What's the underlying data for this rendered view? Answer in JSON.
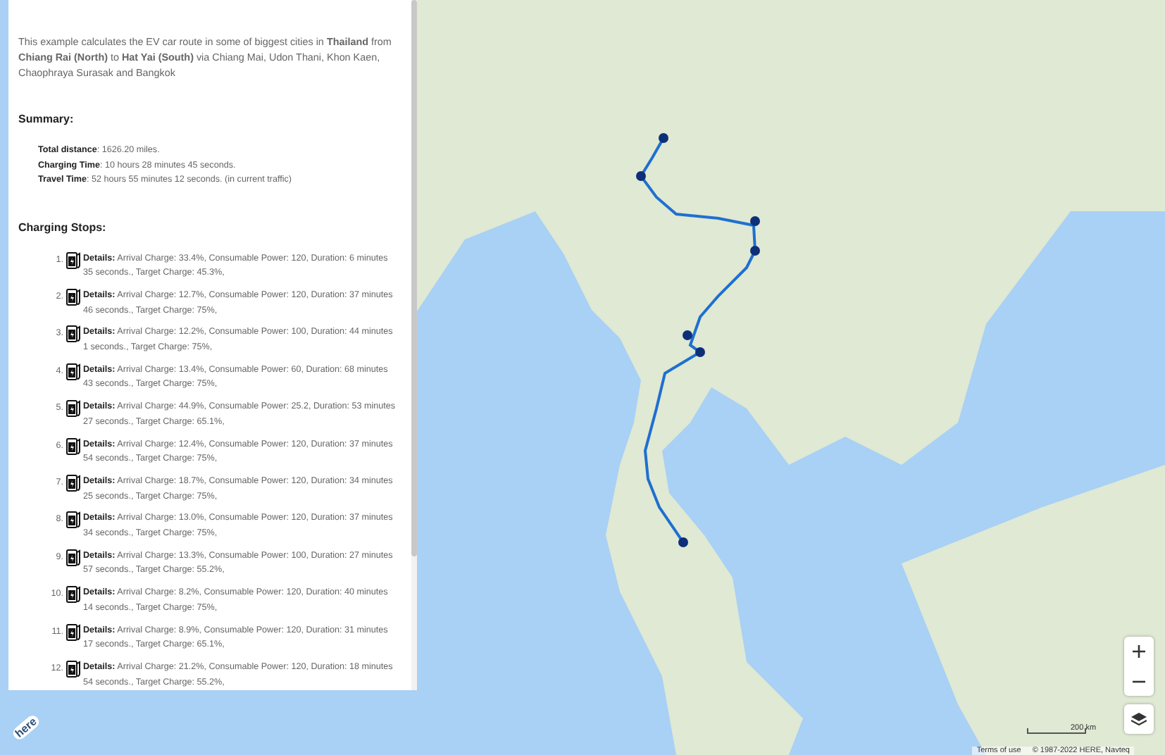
{
  "panel": {
    "intro": "This example calculates the EV car route in some of biggest cities in **Thailand** from **Chiang Rai (North)** to **Hat Yai (South)** via Chiang Mai, Udon Thani, Khon Kaen, Chaophraya Surasak and Bangkok",
    "summary_title": "Summary:",
    "summary": [
      {
        "label": "Total distance",
        "value": ": 1626.20 miles."
      },
      {
        "label": "Charging Time",
        "value": ": 10 hours 28 minutes 45 seconds."
      },
      {
        "label": "Travel Time",
        "value": ": 52 hours 55 minutes 12 seconds. (in current traffic)"
      }
    ],
    "stops_title": "Charging Stops:",
    "stops": [
      {
        "number": "1.",
        "text": "**Details:** Arrival Charge: 33.4%, Consumable Power: 120, Duration: 6 minutes 35 seconds., Target Charge: 45.3%,"
      },
      {
        "number": "2.",
        "text": "**Details:** Arrival Charge: 12.7%, Consumable Power: 120, Duration: 37 minutes 46 seconds., Target Charge: 75%,"
      },
      {
        "number": "3.",
        "text": "**Details:** Arrival Charge: 12.2%, Consumable Power: 100, Duration: 44 minutes 1 seconds., Target Charge: 75%,"
      },
      {
        "number": "4.",
        "text": "**Details:** Arrival Charge: 13.4%, Consumable Power: 60, Duration: 68 minutes 43 seconds., Target Charge: 75%,"
      },
      {
        "number": "5.",
        "text": "**Details:** Arrival Charge: 44.9%, Consumable Power: 25.2, Duration: 53 minutes 27 seconds., Target Charge: 65.1%,"
      },
      {
        "number": "6.",
        "text": "**Details:** Arrival Charge: 12.4%, Consumable Power: 120, Duration: 37 minutes 54 seconds., Target Charge: 75%,"
      },
      {
        "number": "7.",
        "text": "**Details:** Arrival Charge: 18.7%, Consumable Power: 120, Duration: 34 minutes 25 seconds., Target Charge: 75%,"
      },
      {
        "number": "8.",
        "text": "**Details:** Arrival Charge: 13.0%, Consumable Power: 120, Duration: 37 minutes 34 seconds., Target Charge: 75%,"
      },
      {
        "number": "9.",
        "text": "**Details:** Arrival Charge: 13.3%, Consumable Power: 100, Duration: 27 minutes 57 seconds., Target Charge: 55.2%,"
      },
      {
        "number": "10.",
        "text": "**Details:** Arrival Charge: 8.2%, Consumable Power: 120, Duration: 40 minutes 14 seconds., Target Charge: 75%,"
      },
      {
        "number": "11.",
        "text": "**Details:** Arrival Charge: 8.9%, Consumable Power: 120, Duration: 31 minutes 17 seconds., Target Charge: 65.1%,"
      },
      {
        "number": "12.",
        "text": "**Details:** Arrival Charge: 21.2%, Consumable Power: 120, Duration: 18 minutes 54 seconds., Target Charge: 55.2%,"
      }
    ]
  },
  "map": {
    "logo": "here",
    "scale": "200 km",
    "terms": "Terms of use",
    "copyright": "© 1987-2022 HERE, Navteq"
  }
}
